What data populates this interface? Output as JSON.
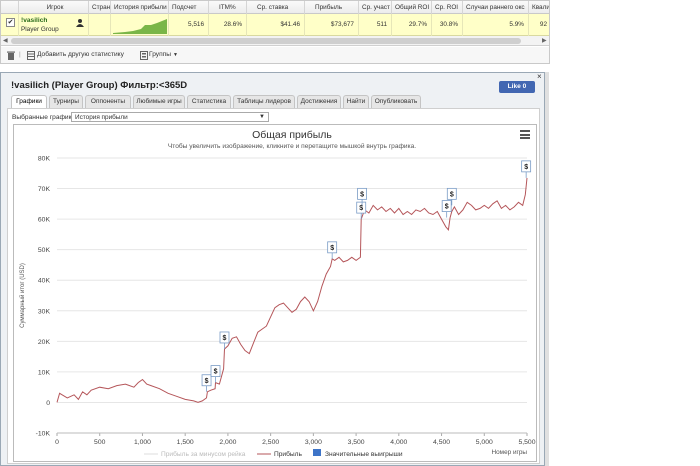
{
  "grid": {
    "headers": [
      "Игрок",
      "Стран",
      "История прибыли",
      "Подсчет",
      "ITM%",
      "Ср. ставка",
      "Прибыль",
      "Ср. участ",
      "Общий ROI",
      "Ср. ROI",
      "Случаи раннего окс",
      "Квали"
    ],
    "row": {
      "name": "!vasilich",
      "group": "Player Group",
      "count": "5,516",
      "itm": "28.6%",
      "avg_stake": "$41.46",
      "profit": "$73,677",
      "avg_entrants": "511",
      "total_roi": "29.7%",
      "avg_roi": "30.8%",
      "early_cases": "5.9%",
      "quali": "92"
    },
    "checkbox": "✔",
    "toolbar": {
      "add_stats": "Добавить другую статистику",
      "groups": "Группы"
    }
  },
  "report": {
    "title": "!vasilich (Player Group) Фильтр:<365D",
    "like_label": "Like 0",
    "close": "×",
    "tabs": [
      "Графики",
      "Турниры",
      "Оппоненты",
      "Любимые игры",
      "Статистика",
      "Таблицы лидеров",
      "Достижения",
      "Найти",
      "Опубликовать"
    ],
    "selected_charts_label": "Выбранные графики:",
    "selected_chart": "История прибыли"
  },
  "colors": {
    "profit_line": "#b5565a",
    "rake_line": "#dddddd",
    "big_win": "#3d74c8",
    "grid": "#e6e6e6",
    "selected_row": "#ffffc8"
  },
  "chart_data": {
    "type": "line",
    "title": "Общая прибыль",
    "subtitle": "Чтобы увеличить изображение, кликните и перетащите мышкой внутрь графика.",
    "ylabel": "Суммарный итог (USD)",
    "xlabel": "Номер игры",
    "xlim": [
      0,
      5500
    ],
    "ylim": [
      -10000,
      80000
    ],
    "x_ticks": [
      "0",
      "500",
      "1,000",
      "1,500",
      "2,000",
      "2,500",
      "3,000",
      "3,500",
      "4,000",
      "4,500",
      "5,000",
      "5,500"
    ],
    "y_ticks": [
      "-10K",
      "0",
      "10K",
      "20K",
      "30K",
      "40K",
      "50K",
      "60K",
      "70K",
      "80K"
    ],
    "grid": true,
    "legend_position": "bottom",
    "legend": [
      "Прибыль за минусом рейка",
      "Прибыль",
      "Значительные выигрыши"
    ],
    "series": [
      {
        "name": "Прибыль",
        "x": [
          0,
          30,
          60,
          120,
          200,
          250,
          300,
          350,
          400,
          500,
          600,
          700,
          800,
          900,
          950,
          1000,
          1050,
          1100,
          1200,
          1300,
          1400,
          1500,
          1600,
          1650,
          1700,
          1750,
          1760,
          1800,
          1850,
          1855,
          1900,
          1950,
          1960,
          2000,
          2050,
          2100,
          2150,
          2200,
          2250,
          2300,
          2350,
          2400,
          2450,
          2500,
          2550,
          2600,
          2650,
          2700,
          2750,
          2800,
          2850,
          2900,
          2950,
          3000,
          3050,
          3100,
          3150,
          3200,
          3220,
          3250,
          3300,
          3350,
          3400,
          3450,
          3500,
          3550,
          3560,
          3600,
          3650,
          3700,
          3750,
          3800,
          3850,
          3900,
          3950,
          4000,
          4050,
          4100,
          4150,
          4200,
          4250,
          4300,
          4350,
          4400,
          4450,
          4500,
          4550,
          4580,
          4600,
          4620,
          4650,
          4700,
          4750,
          4800,
          4850,
          4900,
          4950,
          5000,
          5050,
          5100,
          5150,
          5200,
          5250,
          5300,
          5350,
          5400,
          5450,
          5480,
          5500
        ],
        "y": [
          0,
          3000,
          2500,
          1500,
          2500,
          1000,
          3500,
          2500,
          4000,
          5000,
          4500,
          5500,
          6000,
          5000,
          6500,
          7500,
          6000,
          5500,
          4500,
          3000,
          2000,
          1000,
          500,
          0,
          500,
          1500,
          3500,
          4000,
          4500,
          6500,
          6000,
          11000,
          17500,
          18500,
          21000,
          21500,
          19000,
          17000,
          16000,
          19500,
          23000,
          24000,
          25000,
          28000,
          31000,
          32000,
          32500,
          31000,
          29500,
          30500,
          33000,
          34500,
          33000,
          30000,
          33000,
          38000,
          42000,
          44500,
          47000,
          46500,
          47500,
          46000,
          46500,
          47500,
          46500,
          47500,
          60000,
          63000,
          62000,
          64500,
          63000,
          64000,
          62500,
          63500,
          62000,
          63500,
          61500,
          62500,
          61500,
          63000,
          62500,
          63500,
          62000,
          61500,
          62500,
          60000,
          57500,
          56500,
          60500,
          62500,
          64000,
          61500,
          63000,
          65500,
          64500,
          63000,
          63500,
          64500,
          63500,
          65000,
          66000,
          63500,
          64500,
          63000,
          64000,
          65500,
          64500,
          68000,
          73500
        ]
      },
      {
        "name": "Значительные выигрыши",
        "x": [
          1750,
          1855,
          1960,
          3220,
          3560,
          3570,
          4560,
          4620,
          5490
        ],
        "y": [
          3500,
          6500,
          17500,
          47000,
          60000,
          64500,
          60500,
          64500,
          73500
        ]
      }
    ]
  }
}
